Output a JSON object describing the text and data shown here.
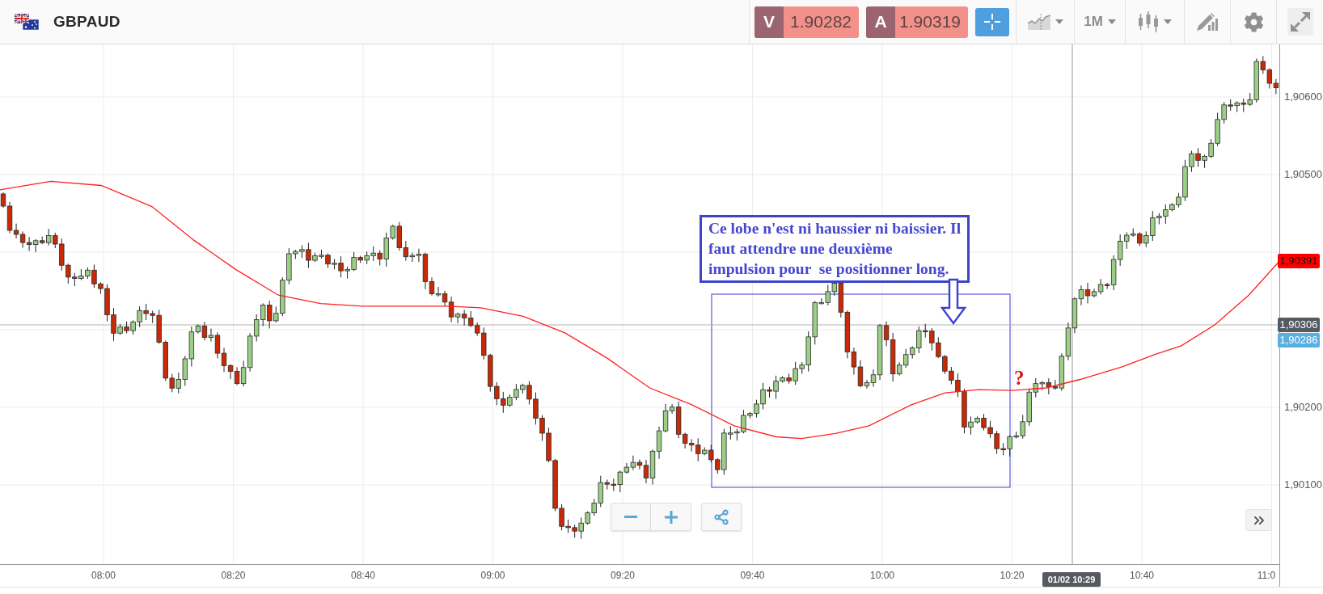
{
  "header": {
    "symbol": "GBPAUD",
    "sell": {
      "letter": "V",
      "price": "1.90282"
    },
    "buy": {
      "letter": "A",
      "price": "1.90319"
    },
    "crosshair_active": true,
    "timeframe": "1M"
  },
  "chart": {
    "price_ticks": [
      "1,90600",
      "1,90500",
      "1,90200",
      "1,90100"
    ],
    "time_ticks": [
      "08:00",
      "08:20",
      "08:40",
      "09:00",
      "09:20",
      "09:40",
      "10:00",
      "10:20",
      "10:40",
      "11:0"
    ],
    "price_markers": [
      {
        "kind": "indicator",
        "label": "1,90391"
      },
      {
        "kind": "crosshair",
        "label": "1,90306"
      },
      {
        "kind": "current",
        "label": "1,90286"
      }
    ],
    "crosshair_time": "01/02 10:29",
    "annotation": {
      "text": "Ce lobe n'est ni haussier ni baissier. Il\nfaut attendre une deuxième\nimpulsion pour  se positionner long.",
      "mark": "?"
    }
  }
}
